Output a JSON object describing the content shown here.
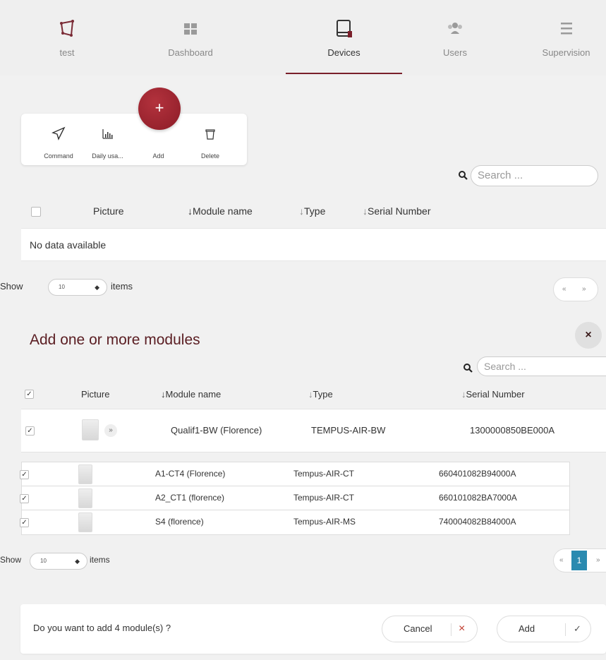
{
  "nav": {
    "items": [
      {
        "label": "test",
        "icon": "polygon-icon"
      },
      {
        "label": "Dashboard",
        "icon": "dashboard-grid-icon"
      },
      {
        "label": "Devices",
        "icon": "device-book-icon",
        "active": true
      },
      {
        "label": "Users",
        "icon": "users-icon"
      },
      {
        "label": "Supervision",
        "icon": "menu-lines-icon"
      }
    ]
  },
  "toolbar": {
    "command": "Command",
    "daily_usage": "Daily usa...",
    "add": "Add",
    "delete": "Delete",
    "fab": "+"
  },
  "search": {
    "placeholder": "Search ..."
  },
  "devices_table": {
    "headers": {
      "picture": "Picture",
      "module_name": "Module name",
      "type": "Type",
      "serial": "Serial Number"
    },
    "sort_arrow": "↓",
    "empty": "No data available",
    "show_label": "Show",
    "show_value": "10",
    "items_label": "items",
    "pager_prev": "«",
    "pager_next": "»"
  },
  "modal": {
    "title": "Add one or more modules",
    "close": "×",
    "search_placeholder": "Search ...",
    "headers": {
      "picture": "Picture",
      "module_name": "Module name",
      "type": "Type",
      "serial": "Serial Number"
    },
    "main_row": {
      "module_name": "Qualif1-BW (Florence)",
      "type": "TEMPUS-AIR-BW",
      "serial": "1300000850BE000A",
      "expand": "»"
    },
    "sub_rows": [
      {
        "module_name": "A1-CT4 (Florence)",
        "type": "Tempus-AIR-CT",
        "serial": "660401082B94000A"
      },
      {
        "module_name": "A2_CT1 (florence)",
        "type": "Tempus-AIR-CT",
        "serial": "660101082BA7000A"
      },
      {
        "module_name": "S4 (florence)",
        "type": "Tempus-AIR-MS",
        "serial": "740004082B84000A"
      }
    ],
    "show_label": "Show",
    "show_value": "10",
    "items_label": "items",
    "pager_prev": "«",
    "pager_page": "1",
    "pager_next": "»",
    "confirm_text": "Do you want to add 4 module(s) ?",
    "cancel_label": "Cancel",
    "cancel_icon": "×",
    "add_label": "Add",
    "add_icon": "✓"
  },
  "colors": {
    "accent": "#7a1f2a",
    "fab": "#9e2430",
    "page_active": "#2a8ab0"
  }
}
